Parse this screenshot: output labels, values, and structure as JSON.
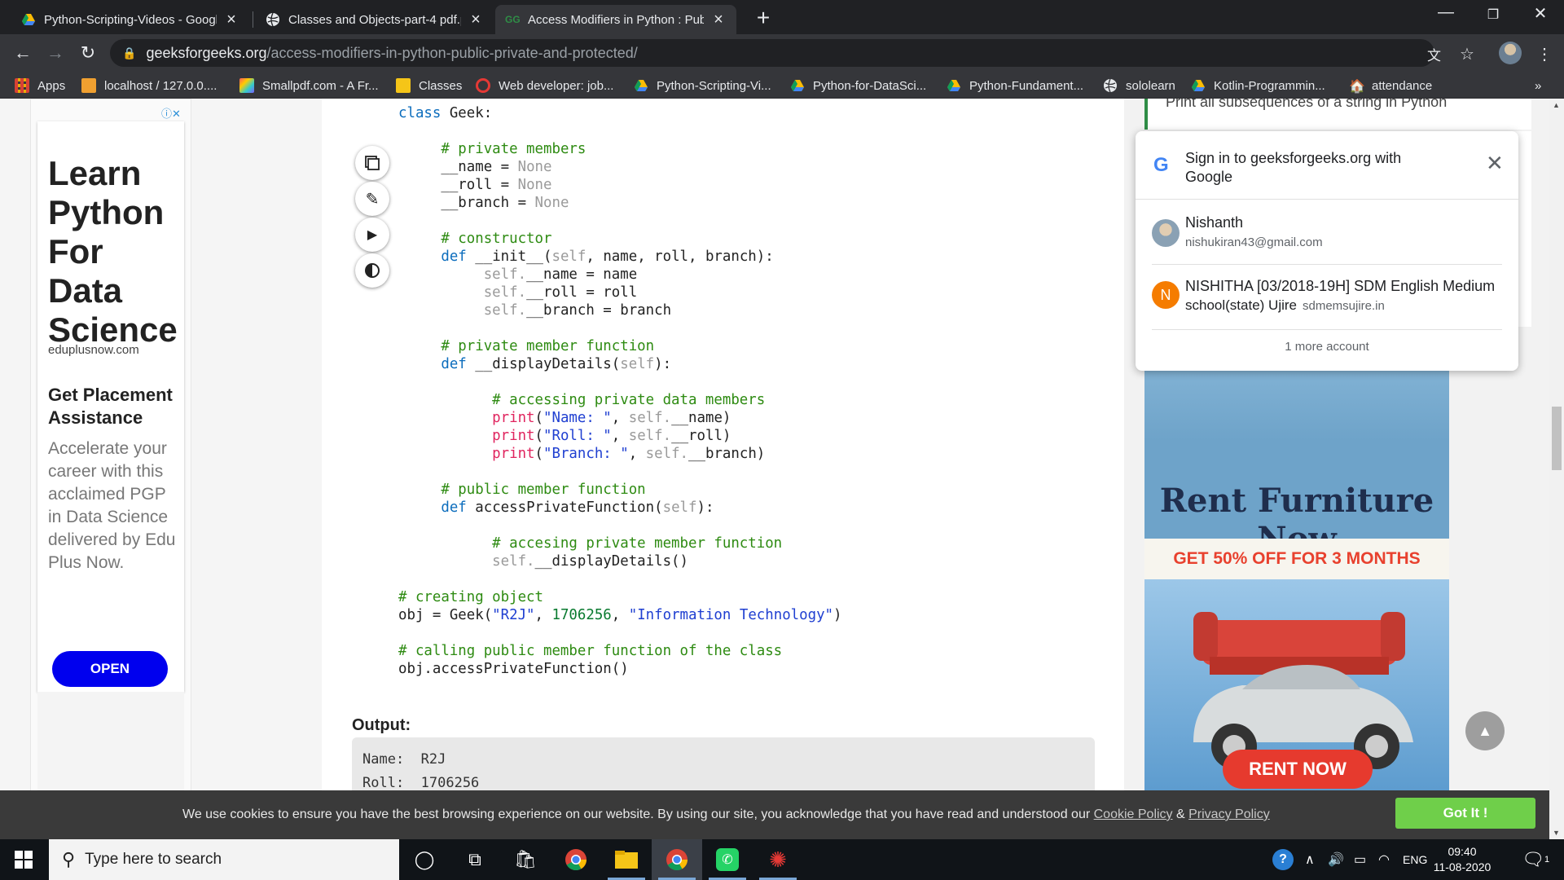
{
  "browser": {
    "tabs": [
      {
        "title": "Python-Scripting-Videos - Googl",
        "icon": "google-drive-icon",
        "active": false
      },
      {
        "title": "Classes and Objects-part-4 pdf.p",
        "icon": "globe-icon",
        "active": false
      },
      {
        "title": "Access Modifiers in Python : Publ",
        "icon": "geeksforgeeks-icon",
        "active": true
      }
    ],
    "new_tab": "+",
    "url_host": "geeksforgeeks.org",
    "url_path": "/access-modifiers-in-python-public-private-and-protected/",
    "bookmarks": [
      {
        "label": "Apps",
        "icon": "apps-grid-icon"
      },
      {
        "label": "localhost / 127.0.0....",
        "icon": "phpmyadmin-icon"
      },
      {
        "label": "Smallpdf.com - A Fr...",
        "icon": "smallpdf-icon"
      },
      {
        "label": "Classes",
        "icon": "folder-icon"
      },
      {
        "label": "Web developer: job...",
        "icon": "jobsite-icon"
      },
      {
        "label": "Python-Scripting-Vi...",
        "icon": "google-drive-icon"
      },
      {
        "label": "Python-for-DataSci...",
        "icon": "google-drive-icon"
      },
      {
        "label": "Python-Fundament...",
        "icon": "google-drive-icon"
      },
      {
        "label": "sololearn",
        "icon": "globe-icon"
      },
      {
        "label": "Kotlin-Programmin...",
        "icon": "google-drive-icon"
      },
      {
        "label": "attendance",
        "icon": "school-icon"
      }
    ],
    "more_bookmarks": "»"
  },
  "left_ad": {
    "headline": "Learn Python For Data Science",
    "domain": "eduplusnow.com",
    "subhead": "Get Placement Assistance",
    "body": "Accelerate your career with this acclaimed PGP in Data Science delivered by Edu Plus Now.",
    "cta": "OPEN"
  },
  "article": {
    "code_controls": [
      "copy-code-icon",
      "edit-code-icon",
      "run-code-icon",
      "theme-toggle-icon"
    ],
    "code": {
      "class_kw": "class",
      "class_name": " Geek:",
      "c_private_members": "# private members",
      "m_name": "__name",
      "m_roll": "__roll",
      "m_branch": "__branch",
      "eq": " = ",
      "none": "None",
      "c_constructor": "# constructor",
      "def_kw": "def",
      "init_sig_a": " __init__(",
      "self": "self",
      "init_sig_b": ", name, roll, branch):",
      "self_name": "self.",
      "assign_name": "__name = name",
      "assign_roll": "__roll = roll",
      "assign_branch": "__branch = branch",
      "c_private_fn": "# private member function",
      "display_sig": " __displayDetails(",
      "close_paren_colon": "):",
      "c_access_private": "# accessing private data members",
      "print_kw": "print",
      "s_name": "\"Name: \"",
      "s_roll": "\"Roll: \"",
      "s_branch": "\"Branch: \"",
      "attr_name": "__name)",
      "attr_roll": "__roll)",
      "attr_branch": "__branch)",
      "c_public_fn": "# public member function",
      "access_sig": " accessPrivateFunction(",
      "c_accesing": "# accesing private member function",
      "call_display": "__displayDetails()",
      "c_creating": "# creating object",
      "obj_a": "obj = Geek(",
      "s_r2j": "\"R2J\"",
      "n_roll": "1706256",
      "s_it": "\"Information Technology\"",
      "c_calling": "# calling public member function of the class",
      "call_access": "obj.accessPrivateFunction()"
    },
    "output_label": "Output:",
    "output_lines": [
      "Name:  R2J",
      "Roll:  1706256"
    ]
  },
  "sidebar": {
    "related_link": "Print all subsequences of a string in Python",
    "ad": {
      "headline": "Rent Furniture Now",
      "offer": "GET 50% OFF FOR 3 MONTHS",
      "cta": "RENT NOW"
    }
  },
  "google_signin": {
    "title": "Sign in to geeksforgeeks.org with Google",
    "accounts": [
      {
        "name": "Nishanth",
        "email": "nishukiran43@gmail.com",
        "avatar": "photo"
      },
      {
        "name": "NISHITHA [03/2018-19H] SDM English Medium",
        "email_overlay": "school(state) Ujire",
        "email": "sdmemsujire.in",
        "avatar_letter": "N",
        "avatar_color": "#f57c00"
      }
    ],
    "more": "1 more account"
  },
  "cookie_banner": {
    "message": "We use cookies to ensure you have the best browsing experience on our website. By using our site, you acknowledge that you have read and understood our ",
    "cookie_policy": "Cookie Policy",
    "amp": " & ",
    "privacy_policy": "Privacy Policy",
    "button": "Got It !"
  },
  "taskbar": {
    "search_placeholder": "Type here to search",
    "apps": [
      "cortana-icon",
      "task-view-icon",
      "store-icon",
      "chrome-icon",
      "file-explorer-icon",
      "chrome-icon",
      "whatsapp-icon",
      "app-icon"
    ],
    "language": "ENG",
    "time": "09:40",
    "date": "11-08-2020",
    "notifications": "1"
  },
  "colors": {
    "accent_green": "#2f8d46",
    "open_button": "#0000ee",
    "rent_button": "#e63a2e",
    "got_it": "#6fcf4a"
  }
}
